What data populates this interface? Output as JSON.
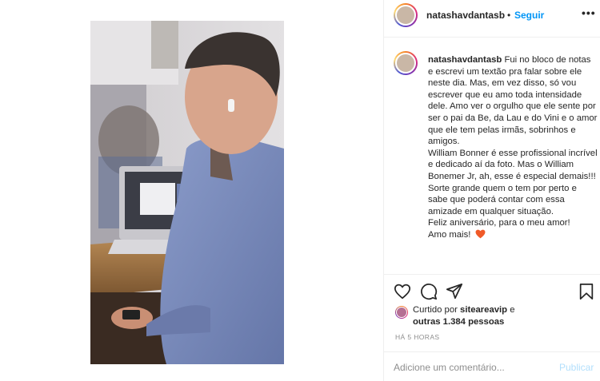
{
  "post": {
    "image_alt": "Homem de camisa azul com fones sem fio usando o celular ao lado de um notebook"
  },
  "header": {
    "username": "natashavdantasb",
    "separator": "•",
    "follow_label": "Seguir",
    "more_icon": "more-horizontal-icon"
  },
  "caption": {
    "username": "natashavdantasb",
    "lines": [
      "Fui no bloco de notas e escrevi um textão pra falar sobre ele neste dia. Mas, em vez disso, só vou escrever que eu amo toda intensidade dele. Amo ver o orgulho que ele sente por ser o pai da Be, da Lau e do Vini e o amor que ele tem pelas irmãs, sobrinhos e amigos.",
      "William Bonner é esse profissional incrível e dedicado aí da foto. Mas o William Bonemer Jr, ah, esse é especial demais!!! Sorte grande quem o tem por perto e sabe que poderá contar com essa amizade em qualquer situação.",
      "Feliz aniversário, para o meu amor!",
      "Amo mais!"
    ],
    "heart_color": "#f05a28"
  },
  "actions": {
    "like_icon": "heart-icon",
    "comment_icon": "comment-icon",
    "share_icon": "share-icon",
    "save_icon": "bookmark-icon"
  },
  "likes": {
    "prefix": "Curtido por ",
    "user": "siteareavip",
    "middle": " e",
    "others": "outras 1.384 pessoas"
  },
  "time": "HÁ 5 HORAS",
  "comment": {
    "placeholder": "Adicione um comentário...",
    "publish_label": "Publicar",
    "publish_color": "#b2dffc"
  }
}
